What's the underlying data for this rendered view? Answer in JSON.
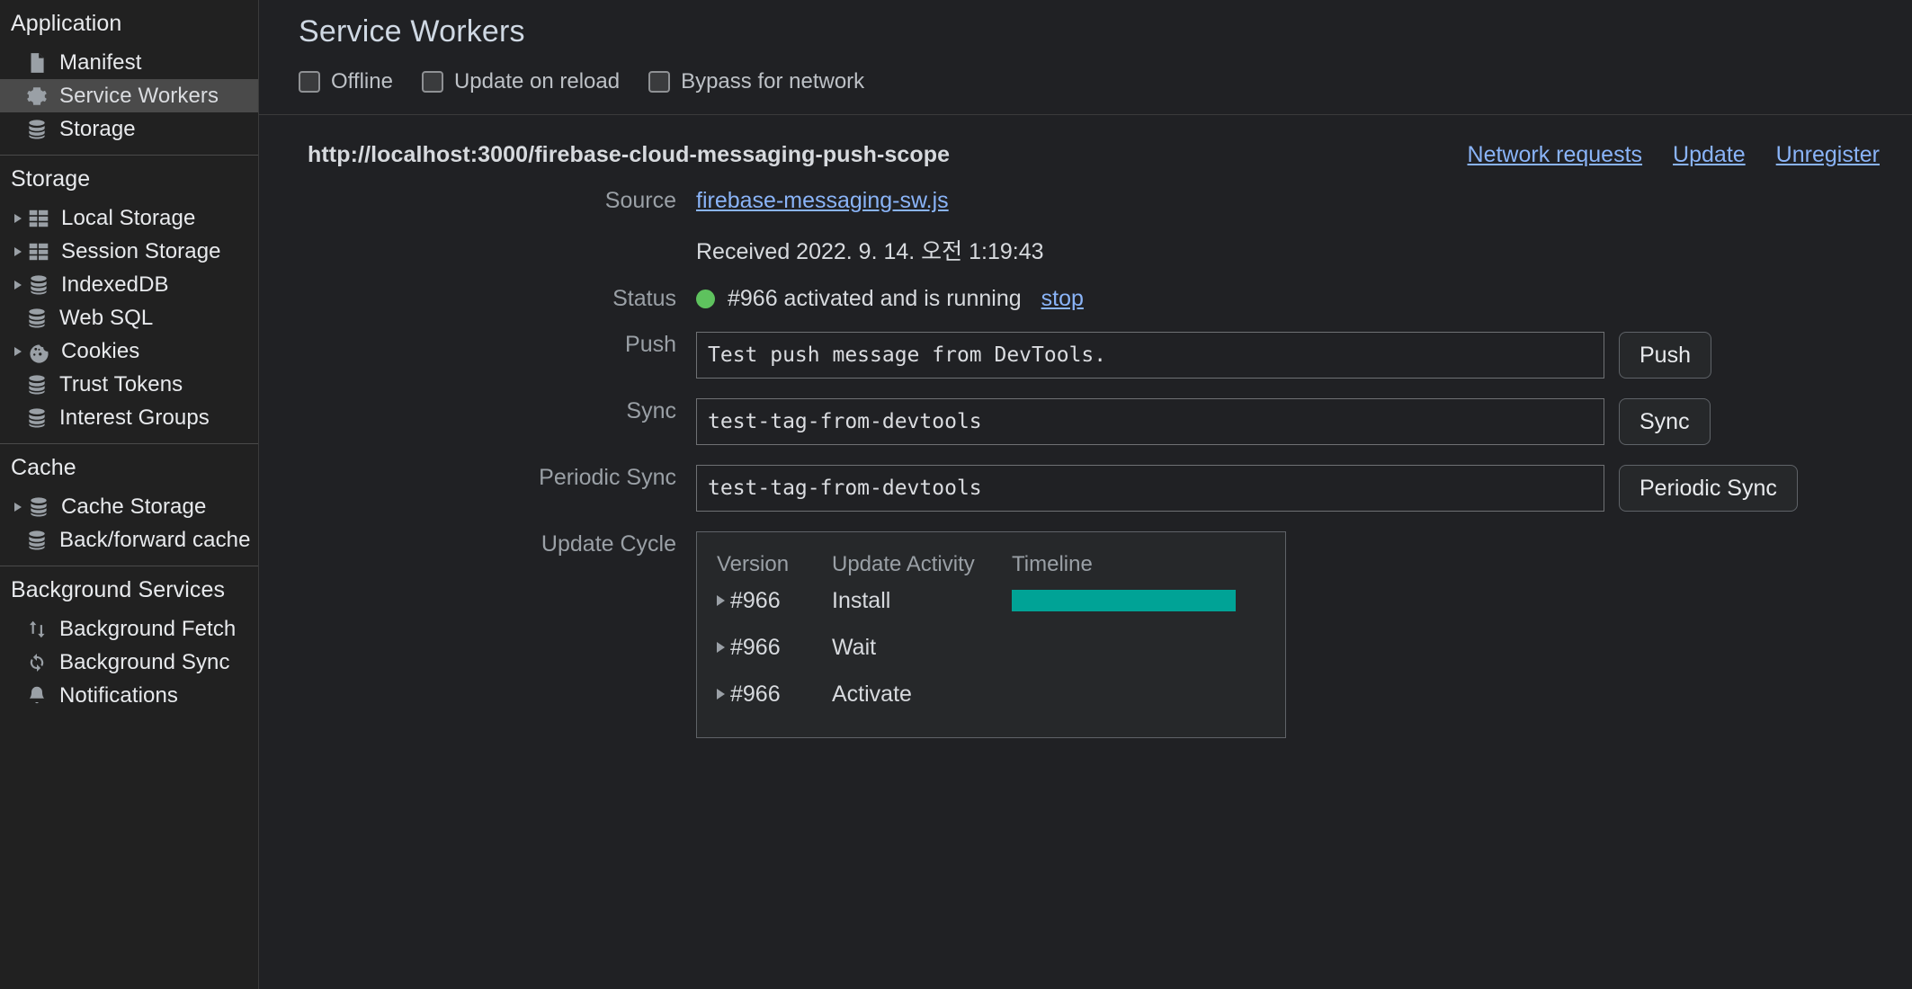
{
  "sidebar": {
    "sections": [
      {
        "title": "Application",
        "items": [
          {
            "label": "Manifest",
            "icon": "document-icon",
            "arrow": false,
            "selected": false
          },
          {
            "label": "Service Workers",
            "icon": "gear-icon",
            "arrow": false,
            "selected": true
          },
          {
            "label": "Storage",
            "icon": "database-icon",
            "arrow": false,
            "selected": false
          }
        ]
      },
      {
        "title": "Storage",
        "items": [
          {
            "label": "Local Storage",
            "icon": "table-icon",
            "arrow": true,
            "selected": false
          },
          {
            "label": "Session Storage",
            "icon": "table-icon",
            "arrow": true,
            "selected": false
          },
          {
            "label": "IndexedDB",
            "icon": "database-icon",
            "arrow": true,
            "selected": false
          },
          {
            "label": "Web SQL",
            "icon": "database-icon",
            "arrow": false,
            "selected": false
          },
          {
            "label": "Cookies",
            "icon": "cookie-icon",
            "arrow": true,
            "selected": false
          },
          {
            "label": "Trust Tokens",
            "icon": "database-icon",
            "arrow": false,
            "selected": false
          },
          {
            "label": "Interest Groups",
            "icon": "database-icon",
            "arrow": false,
            "selected": false
          }
        ]
      },
      {
        "title": "Cache",
        "items": [
          {
            "label": "Cache Storage",
            "icon": "database-icon",
            "arrow": true,
            "selected": false
          },
          {
            "label": "Back/forward cache",
            "icon": "database-icon",
            "arrow": false,
            "selected": false
          }
        ]
      },
      {
        "title": "Background Services",
        "items": [
          {
            "label": "Background Fetch",
            "icon": "updown-arrows-icon",
            "arrow": false,
            "selected": false
          },
          {
            "label": "Background Sync",
            "icon": "sync-icon",
            "arrow": false,
            "selected": false
          },
          {
            "label": "Notifications",
            "icon": "bell-icon",
            "arrow": false,
            "selected": false
          }
        ]
      }
    ]
  },
  "main": {
    "title": "Service Workers",
    "options": [
      {
        "label": "Offline",
        "checked": false
      },
      {
        "label": "Update on reload",
        "checked": false
      },
      {
        "label": "Bypass for network",
        "checked": false
      }
    ],
    "registration": {
      "scope_url": "http://localhost:3000/firebase-cloud-messaging-push-scope",
      "actions": [
        {
          "label": "Network requests"
        },
        {
          "label": "Update"
        },
        {
          "label": "Unregister"
        }
      ],
      "source_label": "Source",
      "source_file": "firebase-messaging-sw.js",
      "received": "Received 2022. 9. 14. 오전 1:19:43",
      "status_label": "Status",
      "status_text": "#966 activated and is running",
      "status_color": "#5ec25e",
      "stop_link": "stop",
      "push_label": "Push",
      "push_value": "Test push message from DevTools.",
      "push_button": "Push",
      "sync_label": "Sync",
      "sync_value": "test-tag-from-devtools",
      "sync_button": "Sync",
      "periodic_label": "Periodic Sync",
      "periodic_value": "test-tag-from-devtools",
      "periodic_button": "Periodic Sync",
      "update_cycle_label": "Update Cycle",
      "update_cycle": {
        "columns": [
          "Version",
          "Update Activity",
          "Timeline"
        ],
        "timeline_color": "#00a396",
        "rows": [
          {
            "version": "#966",
            "activity": "Install",
            "bar_start_pct": 0,
            "bar_width_pct": 82
          },
          {
            "version": "#966",
            "activity": "Wait",
            "bar_start_pct": 0,
            "bar_width_pct": 0
          },
          {
            "version": "#966",
            "activity": "Activate",
            "bar_start_pct": 0,
            "bar_width_pct": 0
          }
        ]
      }
    }
  }
}
